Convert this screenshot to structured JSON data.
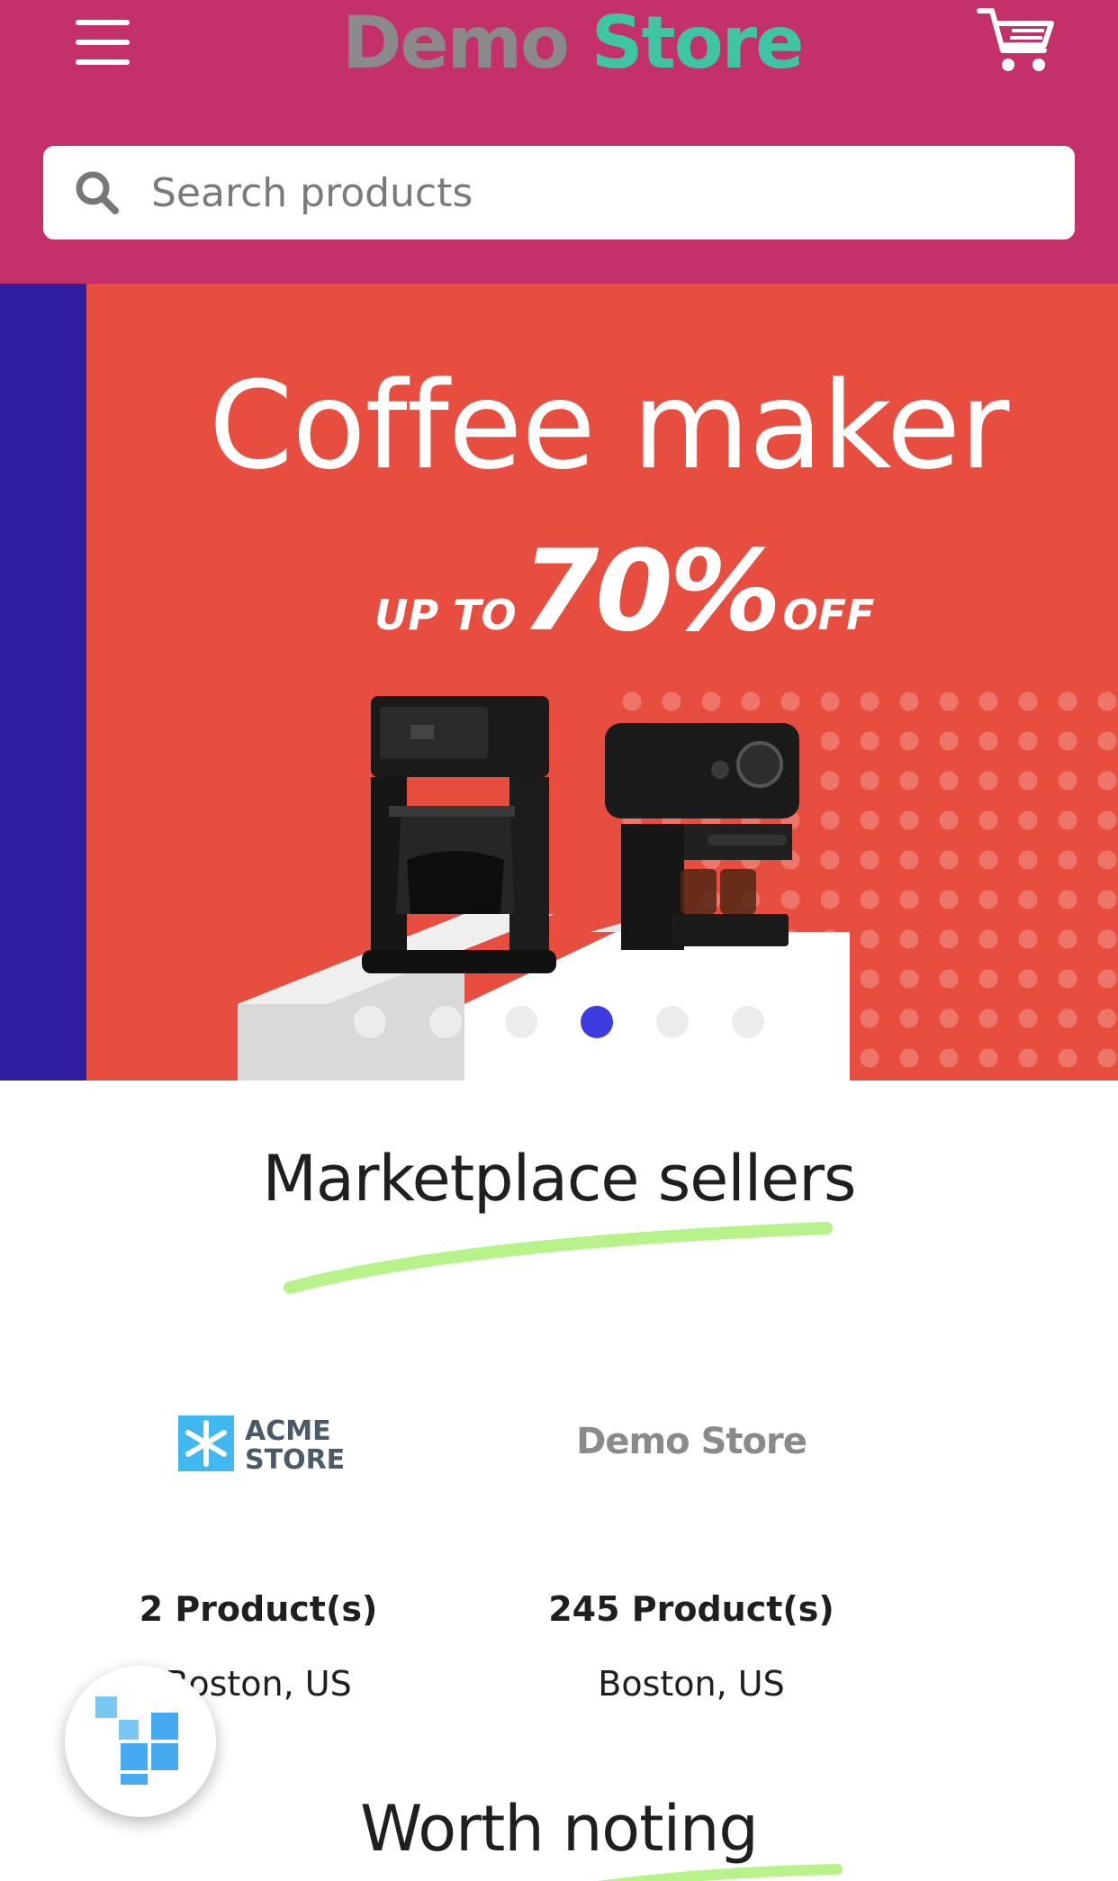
{
  "header": {
    "logo_word_1": "Demo",
    "logo_word_2": "Store",
    "menu_icon": "hamburger-menu-icon",
    "cart_icon": "shopping-cart-icon",
    "background_color": "#c4316a"
  },
  "search": {
    "placeholder": "Search products",
    "value": "",
    "icon": "search-icon"
  },
  "banner": {
    "title": "Coffee maker",
    "offer_prefix": "UP TO",
    "offer_percent": "70%",
    "offer_suffix": "OFF",
    "background_color": "#e84e3f",
    "slide_count": 6,
    "active_slide": 4,
    "active_dot_color": "#3c3ce0"
  },
  "sellers": {
    "title": "Marketplace sellers",
    "underline_color": "#b7f28b",
    "items": [
      {
        "logo_line_1": "ACME",
        "logo_line_2": "STORE",
        "products": "2 Product(s)",
        "location": "Boston, US"
      },
      {
        "logo_word_1": "Demo",
        "logo_word_2": "Store",
        "products": "245 Product(s)",
        "location": "Boston, US"
      }
    ]
  },
  "worth_noting": {
    "title": "Worth noting"
  },
  "floating_button": {
    "icon": "app-grid-icon"
  }
}
